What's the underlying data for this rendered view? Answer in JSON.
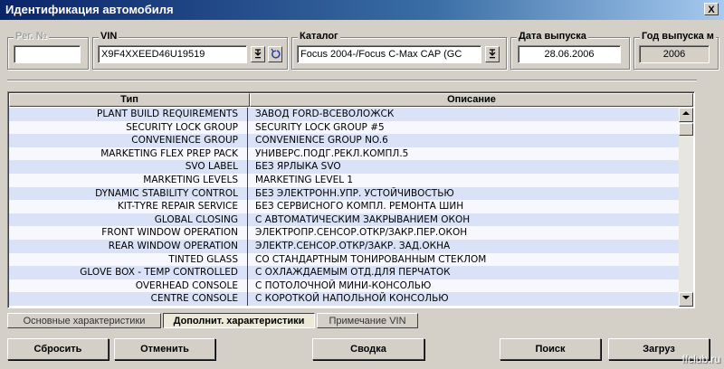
{
  "window": {
    "title": "Идентификация автомобиля",
    "close_glyph": "X"
  },
  "fields": {
    "reg": {
      "label": "Рег. №",
      "value": ""
    },
    "vin": {
      "label": "VIN",
      "value": "X9F4XXEED46U19519"
    },
    "catalog": {
      "label": "Каталог",
      "value": "Focus 2004-/Focus C-Max CAP (GC"
    },
    "release_date": {
      "label": "Дата выпуска",
      "value": "28.06.2006"
    },
    "release_year": {
      "label": "Год выпуска м",
      "value": "2006"
    }
  },
  "grid": {
    "columns": [
      "Тип",
      "Описание"
    ],
    "rows": [
      {
        "type": "PLANT BUILD REQUIREMENTS",
        "desc": "ЗАВОД FORD-ВСЕВОЛОЖСК"
      },
      {
        "type": "SECURITY LOCK GROUP",
        "desc": "SECURITY LOCK GROUP #5"
      },
      {
        "type": "CONVENIENCE GROUP",
        "desc": "CONVENIENCE GROUP NO.6"
      },
      {
        "type": "MARKETING FLEX PREP PACK",
        "desc": "УНИВЕРС.ПОДГ.РЕКЛ.КОМПЛ.5"
      },
      {
        "type": "SVO LABEL",
        "desc": "БЕЗ ЯРЛЫКА SVO"
      },
      {
        "type": "MARKETING LEVELS",
        "desc": "MARKETING LEVEL 1"
      },
      {
        "type": "DYNAMIC STABILITY CONTROL",
        "desc": "БЕЗ ЭЛЕКТРОНН.УПР. УСТОЙЧИВОСТЬЮ"
      },
      {
        "type": "KIT-TYRE REPAIR SERVICE",
        "desc": "БЕЗ СЕРВИСНОГО КОМПЛ. РЕМОНТА ШИН"
      },
      {
        "type": "GLOBAL CLOSING",
        "desc": "С АВТОМАТИЧЕСКИМ ЗАКРЫВАНИЕМ ОКОН"
      },
      {
        "type": "FRONT WINDOW OPERATION",
        "desc": "ЭЛЕКТРОПР.СЕНСОР.ОТКР/ЗАКР.ПЕР.ОКОН"
      },
      {
        "type": "REAR WINDOW OPERATION",
        "desc": "ЭЛЕКТР.СЕНСОР.ОТКР/ЗАКР. ЗАД.ОКНА"
      },
      {
        "type": "TINTED GLASS",
        "desc": "СО СТАНДАРТНЫМ ТОНИРОВАННЫМ СТЕКЛОМ"
      },
      {
        "type": "GLOVE BOX - TEMP CONTROLLED",
        "desc": "С ОХЛАЖДАЕМЫМ ОТД.ДЛЯ ПЕРЧАТОК"
      },
      {
        "type": "OVERHEAD CONSOLE",
        "desc": "С ПОТОЛОЧНОЙ МИНИ-КОНСОЛЬЮ"
      },
      {
        "type": "CENTRE CONSOLE",
        "desc": "С КОРОТКОЙ НАПОЛЬНОЙ КОНСОЛЬЮ"
      }
    ]
  },
  "tabs": [
    "Основные характеристики",
    "Дополнит. характеристики",
    "Примечание VIN"
  ],
  "buttons": {
    "reset": "Сбросить",
    "cancel": "Отменить",
    "summary": "Сводка",
    "search": "Поиск",
    "load": "Загруз"
  },
  "watermark": "ffclub.ru",
  "icons": {
    "dropdown": "dropdown-arrow-icon",
    "undo": "undo-icon",
    "scroll_up": "triangle-up-icon",
    "scroll_down": "triangle-down-icon"
  }
}
